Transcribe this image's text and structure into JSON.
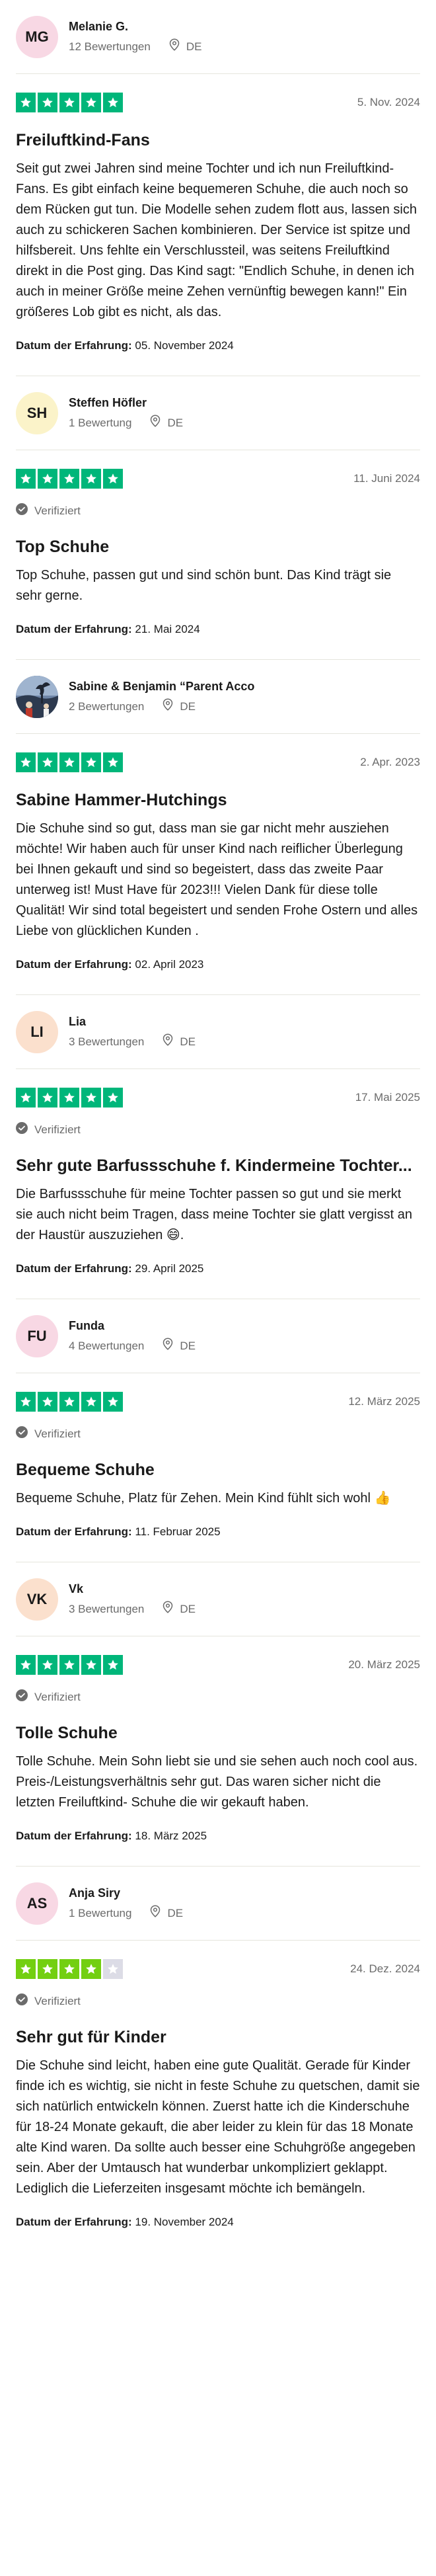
{
  "reviews": [
    {
      "avatar_initials": "MG",
      "avatar_color": "#f8d8e4",
      "name": "Melanie G.",
      "review_count": "12 Bewertungen",
      "location": "DE",
      "stars": 5,
      "star_color": "#00b67a",
      "date": "5. Nov. 2024",
      "verified": false,
      "title": "Freiluftkind-Fans",
      "text": "Seit gut zwei Jahren sind meine Tochter und ich nun Freiluftkind-Fans. Es gibt einfach keine bequemeren Schuhe, die auch noch so dem Rücken gut tun. Die Modelle sehen zudem flott aus, lassen sich auch zu schickeren Sachen kombinieren. Der Service ist spitze und hilfsbereit. Uns fehlte ein Verschlussteil, was seitens Freiluftkind direkt in die Post ging. Das Kind sagt: \"Endlich Schuhe, in denen ich auch in meiner Größe meine Zehen vernünftig bewegen kann!\" Ein größeres Lob gibt es nicht, als das.",
      "experience_label": "Datum der Erfahrung:",
      "experience_date": "05. November 2024"
    },
    {
      "avatar_initials": "SH",
      "avatar_color": "#fbf3c9",
      "name": "Steffen Höfler",
      "review_count": "1 Bewertung",
      "location": "DE",
      "stars": 5,
      "star_color": "#00b67a",
      "date": "11. Juni 2024",
      "verified": true,
      "verified_label": "Verifiziert",
      "title": "Top Schuhe",
      "text": "Top Schuhe, passen gut und sind schön bunt. Das Kind trägt sie sehr gerne.",
      "experience_label": "Datum der Erfahrung:",
      "experience_date": "21. Mai 2024"
    },
    {
      "avatar_initials": "",
      "avatar_color": "#3b4a66",
      "avatar_image": "photo",
      "name": "Sabine & Benjamin “Parent Acco",
      "review_count": "2 Bewertungen",
      "location": "DE",
      "stars": 5,
      "star_color": "#00b67a",
      "date": "2. Apr. 2023",
      "verified": false,
      "title": "Sabine Hammer-Hutchings",
      "text": "Die Schuhe sind so gut, dass man sie gar nicht mehr ausziehen möchte! Wir haben auch für unser Kind nach reiflicher Überlegung bei Ihnen gekauft und sind so begeistert, dass das zweite Paar unterweg ist! Must Have für 2023!!! Vielen Dank für diese tolle Qualität! Wir sind total begeistert und senden Frohe Ostern und alles Liebe von glücklichen Kunden .",
      "experience_label": "Datum der Erfahrung:",
      "experience_date": "02. April 2023"
    },
    {
      "avatar_initials": "LI",
      "avatar_color": "#fbe0cd",
      "name": "Lia",
      "review_count": "3 Bewertungen",
      "location": "DE",
      "stars": 5,
      "star_color": "#00b67a",
      "date": "17. Mai 2025",
      "verified": true,
      "verified_label": "Verifiziert",
      "title": "Sehr gute Barfussschuhe f. Kindermeine Tochter...",
      "text": "Die Barfussschuhe für meine Tochter passen so gut und sie merkt sie auch nicht beim Tragen, dass meine Tochter sie glatt vergisst an der Haustür auszuziehen 😄.",
      "experience_label": "Datum der Erfahrung:",
      "experience_date": "29. April 2025"
    },
    {
      "avatar_initials": "FU",
      "avatar_color": "#f8d8e4",
      "name": "Funda",
      "review_count": "4 Bewertungen",
      "location": "DE",
      "stars": 5,
      "star_color": "#00b67a",
      "date": "12. März 2025",
      "verified": true,
      "verified_label": "Verifiziert",
      "title": "Bequeme Schuhe",
      "text": "Bequeme Schuhe, Platz für Zehen. Mein Kind fühlt sich wohl 👍",
      "experience_label": "Datum der Erfahrung:",
      "experience_date": "11. Februar 2025"
    },
    {
      "avatar_initials": "VK",
      "avatar_color": "#fbe0cd",
      "name": "Vk",
      "review_count": "3 Bewertungen",
      "location": "DE",
      "stars": 5,
      "star_color": "#00b67a",
      "date": "20. März 2025",
      "verified": true,
      "verified_label": "Verifiziert",
      "title": "Tolle Schuhe",
      "text": "Tolle Schuhe. Mein Sohn liebt sie und sie sehen auch noch cool aus. Preis-/Leistungsverhältnis sehr gut. Das waren sicher nicht die letzten Freiluftkind- Schuhe die wir gekauft haben.",
      "experience_label": "Datum der Erfahrung:",
      "experience_date": "18. März 2025"
    },
    {
      "avatar_initials": "AS",
      "avatar_color": "#f8d8e4",
      "name": "Anja Siry",
      "review_count": "1 Bewertung",
      "location": "DE",
      "stars": 4,
      "star_color": "#73cf11",
      "date": "24. Dez. 2024",
      "verified": true,
      "verified_label": "Verifiziert",
      "title": "Sehr gut für Kinder",
      "text": "Die Schuhe sind leicht, haben eine gute Qualität. Gerade für Kinder finde ich es wichtig, sie nicht in feste Schuhe zu quetschen, damit sie sich natürlich entwickeln können. Zuerst hatte ich die Kinderschuhe für 18-24 Monate gekauft, die aber leider zu klein für das 18 Monate alte Kind waren. Da sollte auch besser eine Schuhgröße angegeben sein. Aber der Umtausch hat wunderbar unkompliziert geklappt. Lediglich die Lieferzeiten insgesamt möchte ich bemängeln.",
      "experience_label": "Datum der Erfahrung:",
      "experience_date": "19. November 2024"
    }
  ]
}
